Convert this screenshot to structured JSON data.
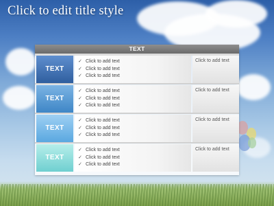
{
  "slide": {
    "title": "Click to edit title style"
  },
  "table": {
    "header": "TEXT",
    "rows": [
      {
        "label": "TEXT",
        "color_top": "#5f8fcf",
        "color_bottom": "#2f5e9e",
        "items": [
          "Click to add text",
          "Click to add text",
          "Click to add text"
        ],
        "side": "Click to add text"
      },
      {
        "label": "TEXT",
        "color_top": "#7cb4e4",
        "color_bottom": "#3e86c6",
        "items": [
          "Click to add text",
          "Click to add text",
          "Click to add text"
        ],
        "side": "Click to add text"
      },
      {
        "label": "TEXT",
        "color_top": "#9ed0f3",
        "color_bottom": "#5aa8e0",
        "items": [
          "Click to add text",
          "Click to add text",
          "Click to add text"
        ],
        "side": "Click to add text"
      },
      {
        "label": "TEXT",
        "color_top": "#b6eeea",
        "color_bottom": "#6fcfd0",
        "items": [
          "Click to add text",
          "Click to add text",
          "Click to add text"
        ],
        "side": "Click to add text"
      }
    ]
  },
  "icons": {
    "bullet": "check-icon"
  }
}
